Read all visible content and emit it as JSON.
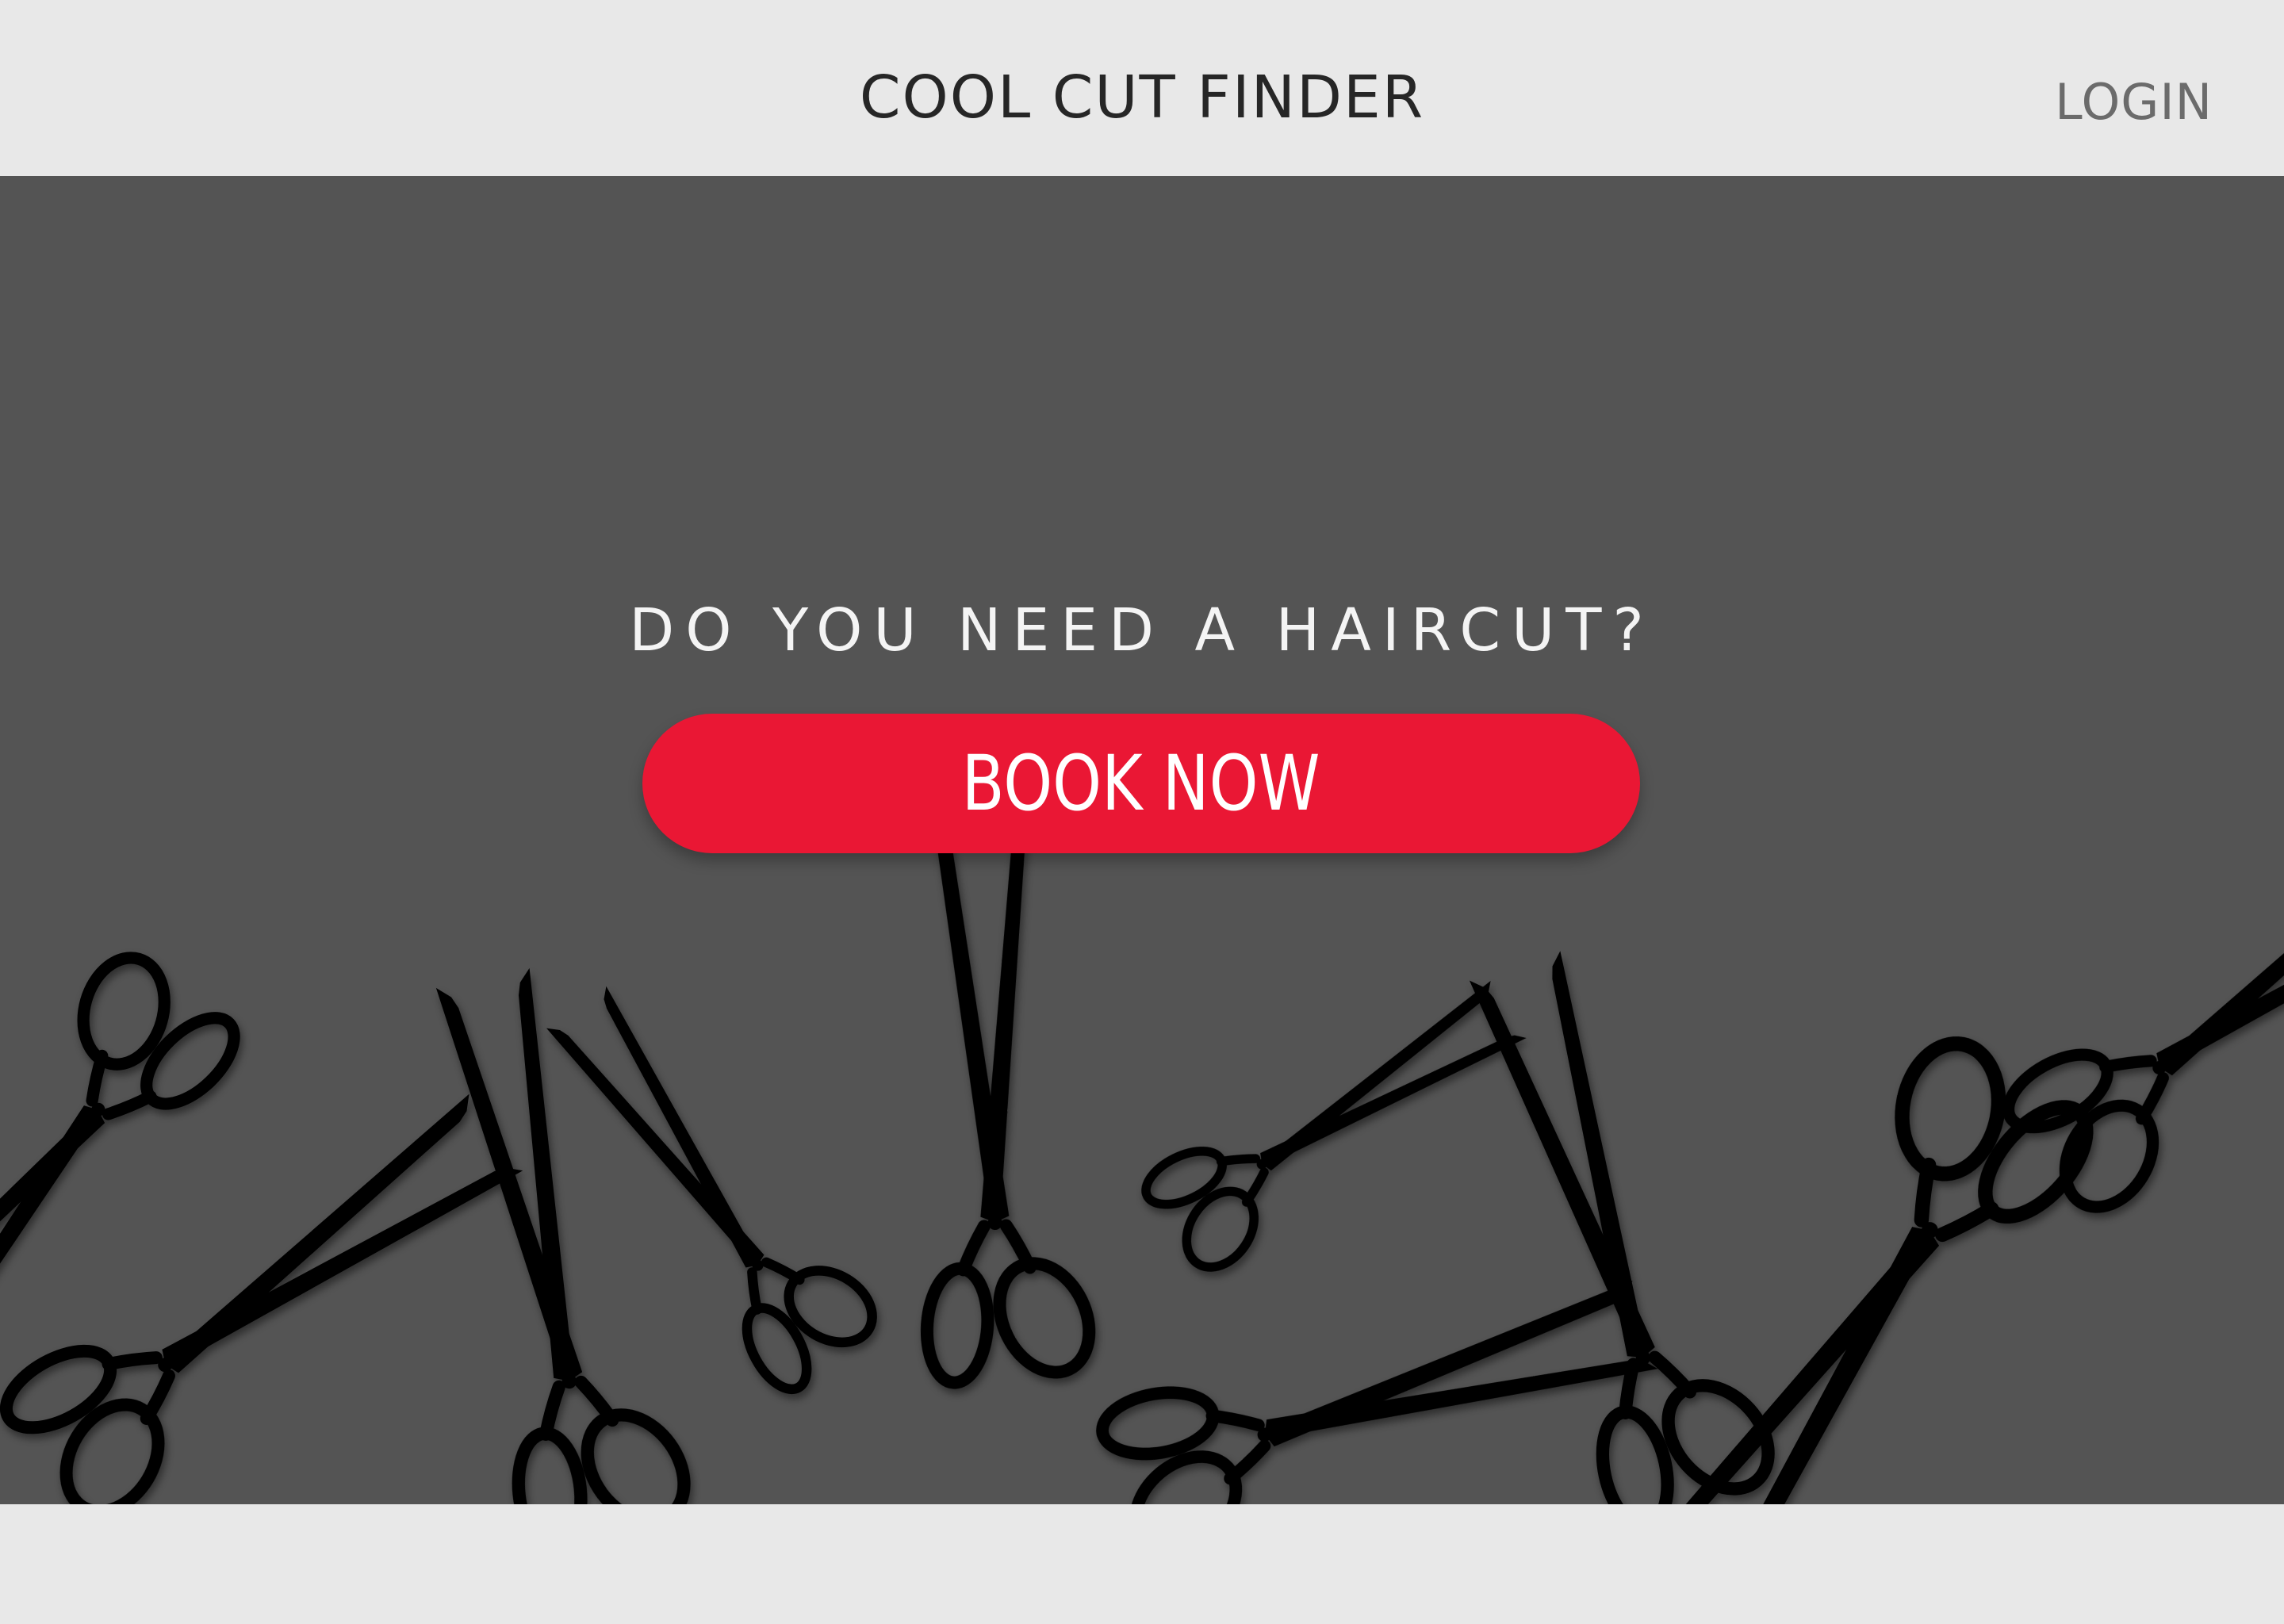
{
  "header": {
    "title": "COOL CUT FINDER",
    "login_label": "LOGIN"
  },
  "hero": {
    "question": "DO YOU NEED A HAIRCUT?",
    "cta_label": "BOOK NOW",
    "decoration_icon": "scissors-icon"
  },
  "colors": {
    "header_bg": "#e8e8e8",
    "hero_bg": "#545454",
    "cta_bg": "#ea1734",
    "title_text": "#262626",
    "login_text": "#6b6b6b",
    "scissors": "#000000"
  }
}
